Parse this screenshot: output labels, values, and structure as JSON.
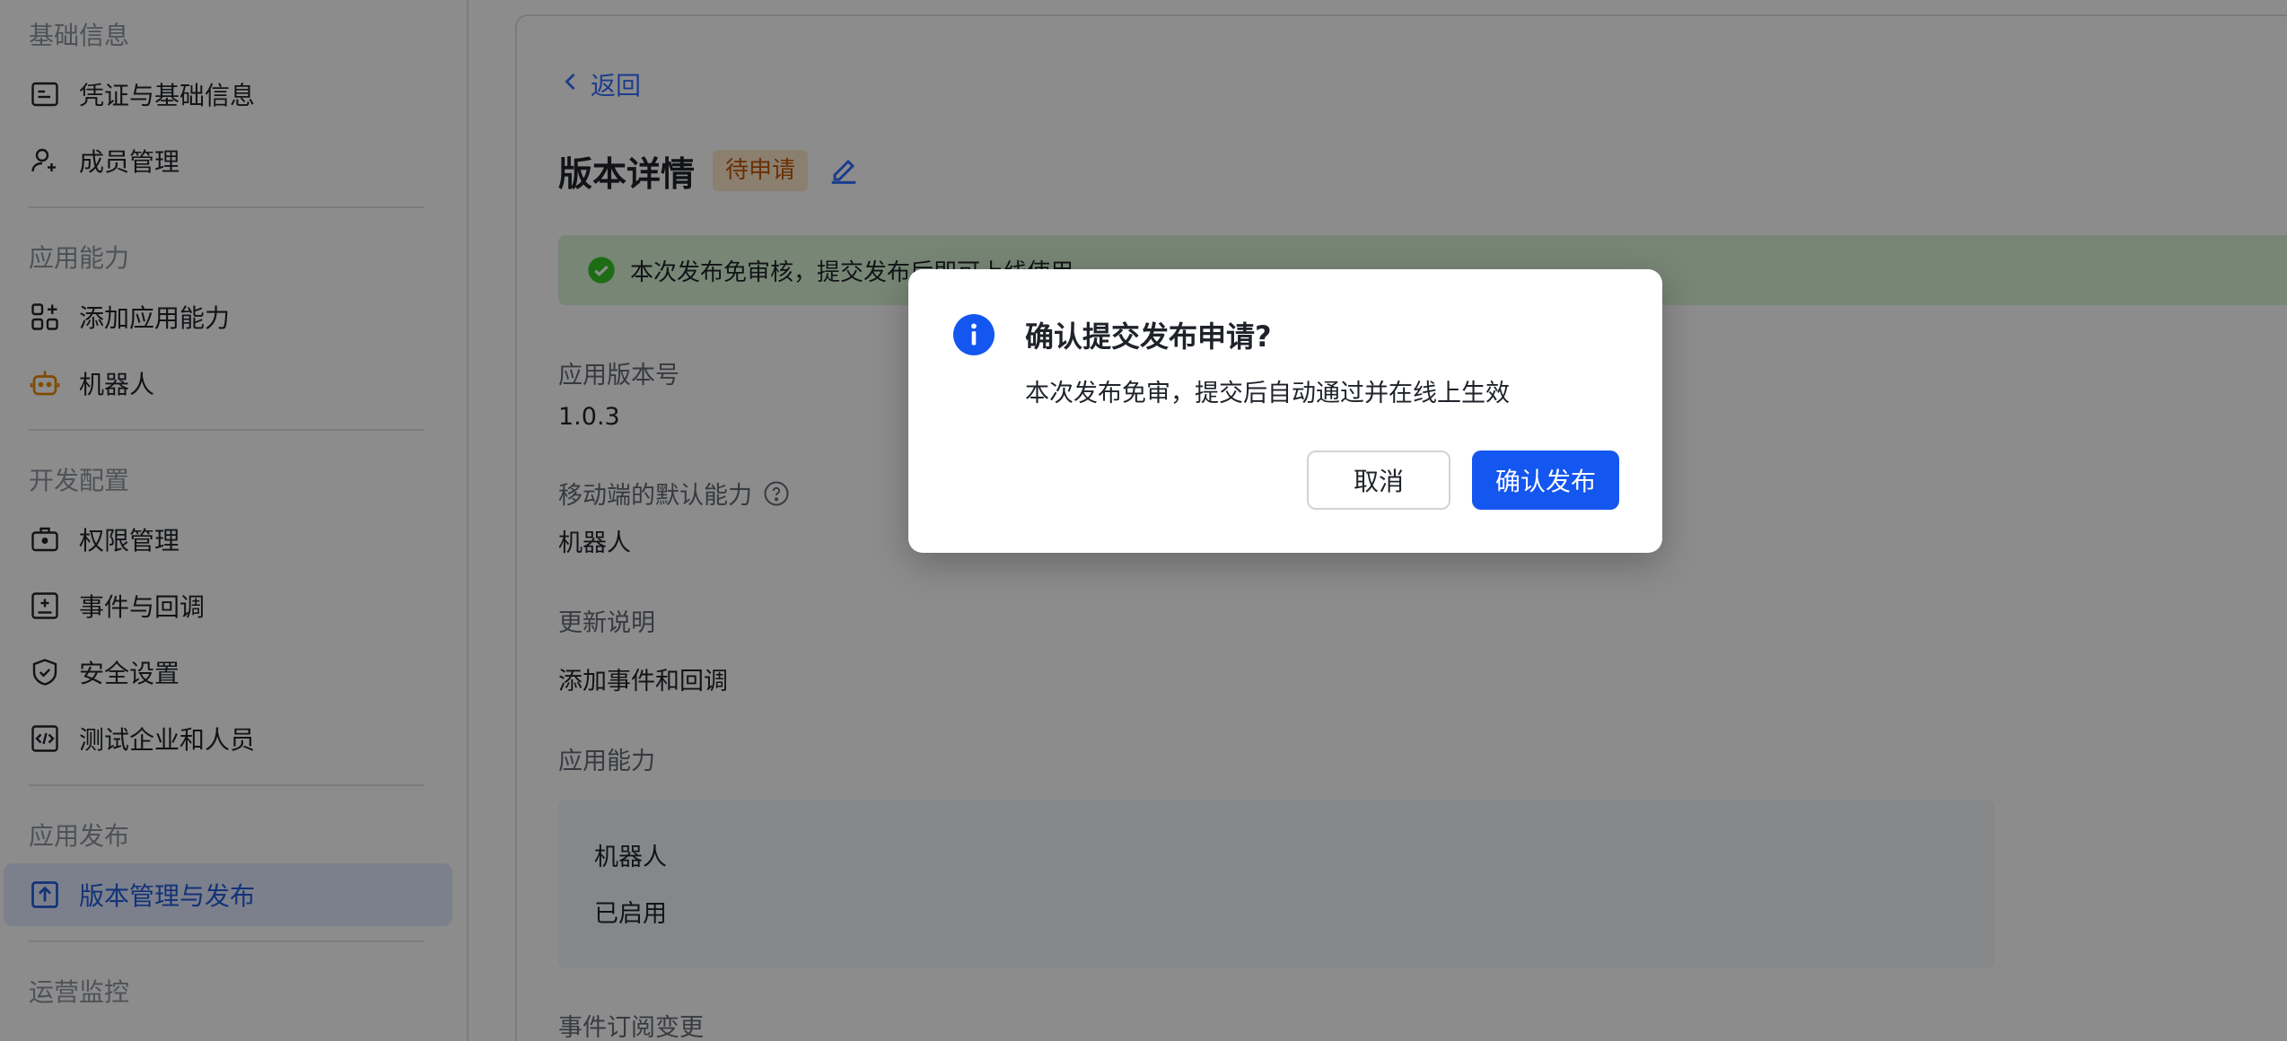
{
  "sidebar": {
    "groups": [
      {
        "title": "基础信息",
        "items": [
          "凭证与基础信息",
          "成员管理"
        ]
      },
      {
        "title": "应用能力",
        "items": [
          "添加应用能力",
          "机器人"
        ]
      },
      {
        "title": "开发配置",
        "items": [
          "权限管理",
          "事件与回调",
          "安全设置",
          "测试企业和人员"
        ]
      },
      {
        "title": "应用发布",
        "items": [
          "版本管理与发布"
        ]
      },
      {
        "title": "运营监控"
      }
    ]
  },
  "main": {
    "back_label": "返回",
    "title": "版本详情",
    "status_tag": "待申请",
    "banner_text": "本次发布免审核，提交发布后即可上线使用",
    "fields": {
      "version_label": "应用版本号",
      "version_value": "1.0.3",
      "mobile_default_label": "移动端的默认能力",
      "mobile_default_value": "机器人",
      "update_note_label": "更新说明",
      "update_note_value": "添加事件和回调",
      "capability_label": "应用能力",
      "capability_name": "机器人",
      "capability_status": "已启用",
      "event_sub_label": "事件订阅变更"
    }
  },
  "dialog": {
    "title": "确认提交发布申请?",
    "body": "本次发布免审，提交后自动通过并在线上生效",
    "cancel_label": "取消",
    "confirm_label": "确认发布"
  },
  "colors": {
    "primary": "#1456f0",
    "link": "#3370ff",
    "success": "#34c724",
    "warning_tag_bg": "#fee7cd",
    "warning_tag_text": "#c25705"
  }
}
